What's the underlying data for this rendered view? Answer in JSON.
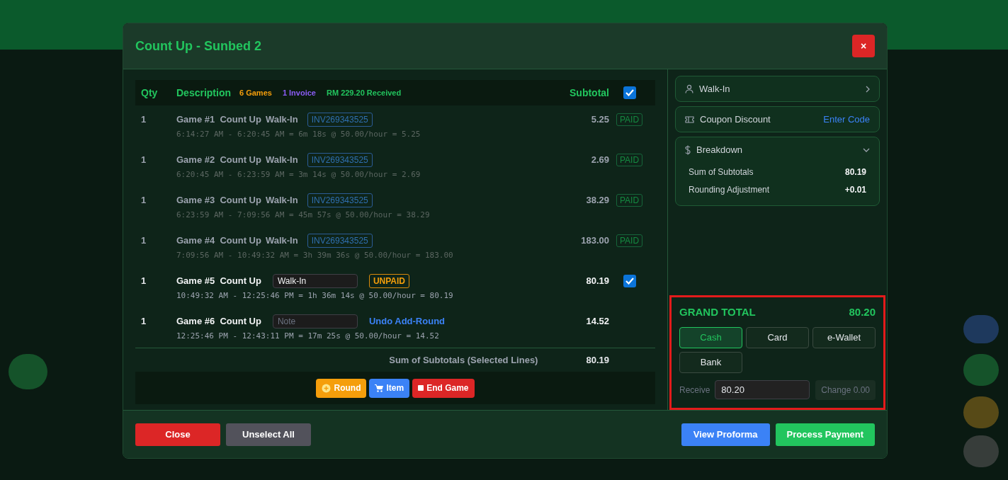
{
  "dialog": {
    "title": "Count Up - Sunbed 2",
    "close_label": "×"
  },
  "table": {
    "columns": [
      "Qty",
      "Description",
      "Subtotal"
    ],
    "badges": [
      {
        "text": "6 Games",
        "color": "#f59e0b"
      },
      {
        "text": "1 Invoice",
        "color": "#8b5cf6"
      },
      {
        "text": "RM 229.20 Received",
        "color": "#22c55e"
      }
    ],
    "select_all_checked": true,
    "rows": [
      {
        "kind": "paid",
        "qty": "1",
        "title": "Game #1  Count Up",
        "customer": "Walk-In",
        "invoice": "INV269343525",
        "status": "PAID",
        "detail": "6:14:27 AM - 6:20:45 AM = 6m 18s @ 50.00/hour = 5.25",
        "subtotal": "5.25"
      },
      {
        "kind": "paid",
        "qty": "1",
        "title": "Game #2  Count Up",
        "customer": "Walk-In",
        "invoice": "INV269343525",
        "status": "PAID",
        "detail": "6:20:45 AM - 6:23:59 AM = 3m 14s @ 50.00/hour = 2.69",
        "subtotal": "2.69"
      },
      {
        "kind": "paid",
        "qty": "1",
        "title": "Game #3  Count Up",
        "customer": "Walk-In",
        "invoice": "INV269343525",
        "status": "PAID",
        "detail": "6:23:59 AM - 7:09:56 AM = 45m 57s @ 50.00/hour = 38.29",
        "subtotal": "38.29"
      },
      {
        "kind": "paid",
        "qty": "1",
        "title": "Game #4  Count Up",
        "customer": "Walk-In",
        "invoice": "INV269343525",
        "status": "PAID",
        "detail": "7:09:56 AM - 10:49:32 AM = 3h 39m 36s @ 50.00/hour = 183.00",
        "subtotal": "183.00"
      },
      {
        "kind": "unpaid",
        "qty": "1",
        "title": "Game #5  Count Up",
        "customer_value": "Walk-In",
        "unpaid_tag": "UNPAID",
        "detail": "10:49:32 AM - 12:25:46 PM = 1h 36m 14s @ 50.00/hour = 80.19",
        "subtotal": "80.19",
        "checked": true
      },
      {
        "kind": "open",
        "qty": "1",
        "title": "Game #6  Count Up",
        "note_placeholder": "Note",
        "link": "Undo Add-Round",
        "detail": "12:25:46 PM - 12:43:11 PM = 17m 25s @ 50.00/hour = 14.52",
        "subtotal": "14.52"
      }
    ],
    "sum_label": "Sum of Subtotals (Selected Lines)",
    "sum_value": "80.19",
    "actions": [
      {
        "kind": "round",
        "label": "Round"
      },
      {
        "kind": "item",
        "label": "Item"
      },
      {
        "kind": "end",
        "label": "End Game"
      }
    ]
  },
  "side": {
    "customer": "Walk-In",
    "coupon_label": "Coupon Discount",
    "coupon_link": "Enter Code",
    "breakdown_title": "Breakdown",
    "breakdown_expanded": true,
    "breakdown": [
      {
        "label": "Sum of Subtotals",
        "value": "80.19"
      },
      {
        "label": "Rounding Adjustment",
        "value": "+0.01"
      }
    ],
    "grand_total_label": "GRAND TOTAL",
    "grand_total": "80.20",
    "methods": [
      {
        "label": "Cash",
        "selected": true
      },
      {
        "label": "Card",
        "selected": false
      },
      {
        "label": "e-Wallet",
        "selected": false
      },
      {
        "label": "Bank",
        "selected": false
      }
    ],
    "receive_label": "Receive",
    "receive_value": "80.20",
    "change_label": "Change",
    "change_value": "0.00"
  },
  "footer": {
    "left": [
      {
        "kind": "danger",
        "label": "Close"
      },
      {
        "kind": "muted",
        "label": "Unselect All"
      }
    ],
    "right": [
      {
        "kind": "info",
        "label": "View Proforma"
      },
      {
        "kind": "success",
        "label": "Process Payment"
      }
    ]
  }
}
